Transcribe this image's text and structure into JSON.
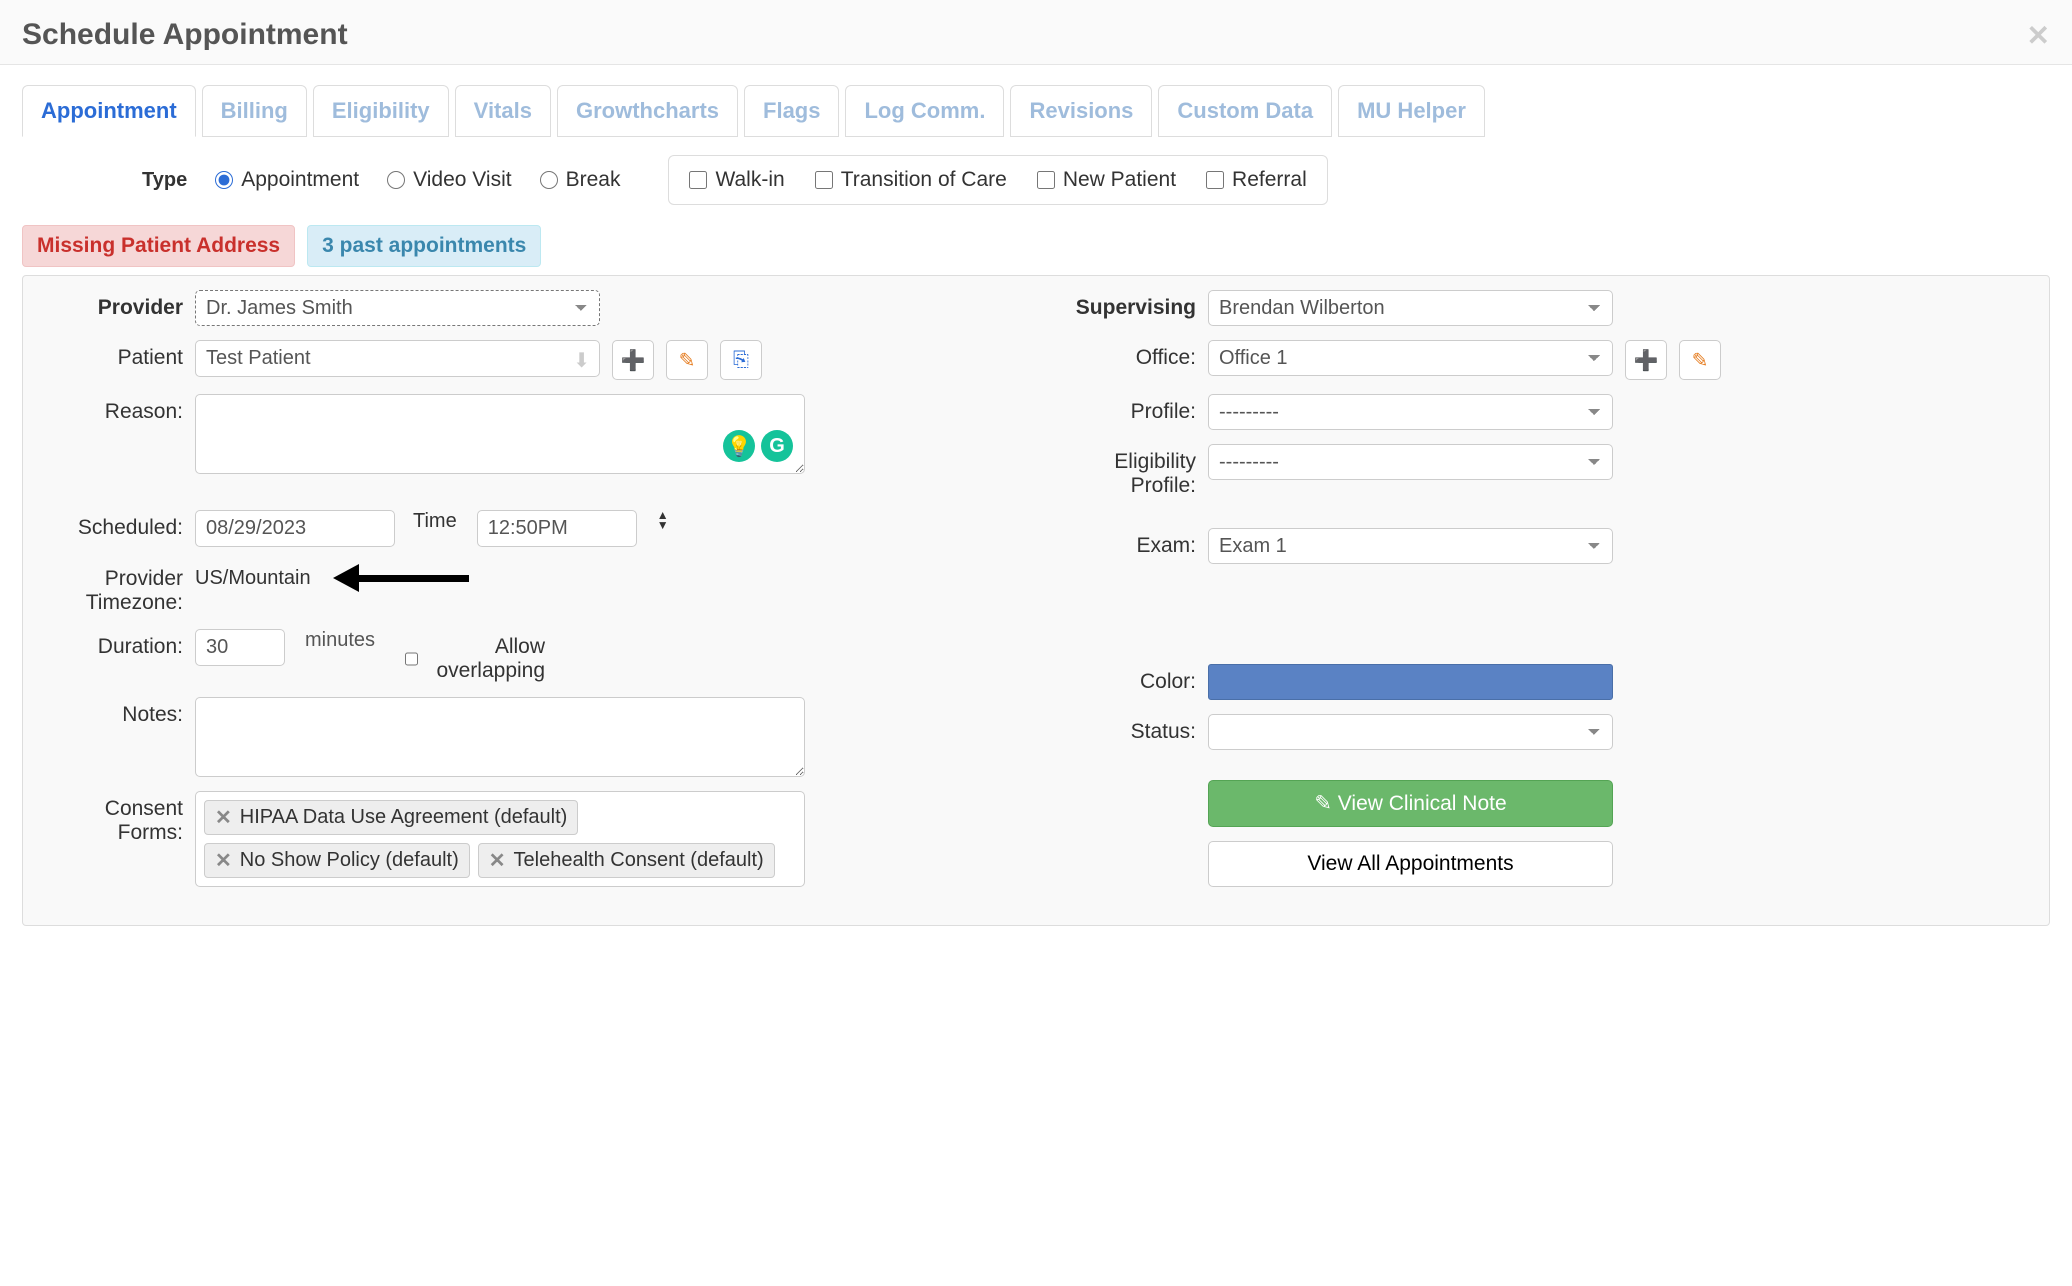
{
  "header": {
    "title": "Schedule Appointment"
  },
  "tabs": [
    "Appointment",
    "Billing",
    "Eligibility",
    "Vitals",
    "Growthcharts",
    "Flags",
    "Log Comm.",
    "Revisions",
    "Custom Data",
    "MU Helper"
  ],
  "type": {
    "label": "Type",
    "radios": {
      "appointment": "Appointment",
      "video": "Video Visit",
      "break": "Break"
    },
    "checks": {
      "walkin": "Walk-in",
      "toc": "Transition of Care",
      "newpatient": "New Patient",
      "referral": "Referral"
    }
  },
  "badges": {
    "missing": "Missing Patient Address",
    "past": "3 past appointments"
  },
  "left": {
    "provider": {
      "label": "Provider",
      "value": "Dr. James Smith"
    },
    "patient": {
      "label": "Patient",
      "value": "Test Patient"
    },
    "reason": {
      "label": "Reason:",
      "value": ""
    },
    "scheduled": {
      "label": "Scheduled:",
      "date": "08/29/2023",
      "time_label": "Time",
      "time": "12:50PM"
    },
    "tz": {
      "label": "Provider Timezone:",
      "value": "US/Mountain"
    },
    "duration": {
      "label": "Duration:",
      "value": "30",
      "unit": "minutes",
      "overlap": "Allow overlapping"
    },
    "notes": {
      "label": "Notes:",
      "value": ""
    },
    "consent": {
      "label": "Consent Forms:",
      "items": [
        "HIPAA Data Use Agreement (default)",
        "No Show Policy (default)",
        "Telehealth Consent (default)"
      ]
    }
  },
  "right": {
    "supervising": {
      "label": "Supervising",
      "value": "Brendan Wilberton"
    },
    "office": {
      "label": "Office:",
      "value": "Office 1"
    },
    "profile": {
      "label": "Profile:",
      "value": "---------"
    },
    "elig": {
      "label": "Eligibility Profile:",
      "value": "---------"
    },
    "exam": {
      "label": "Exam:",
      "value": "Exam 1"
    },
    "color": {
      "label": "Color:",
      "value": "#5a82c4"
    },
    "status": {
      "label": "Status:",
      "value": ""
    },
    "buttons": {
      "clinical": "View Clinical Note",
      "allappts": "View All Appointments"
    }
  }
}
